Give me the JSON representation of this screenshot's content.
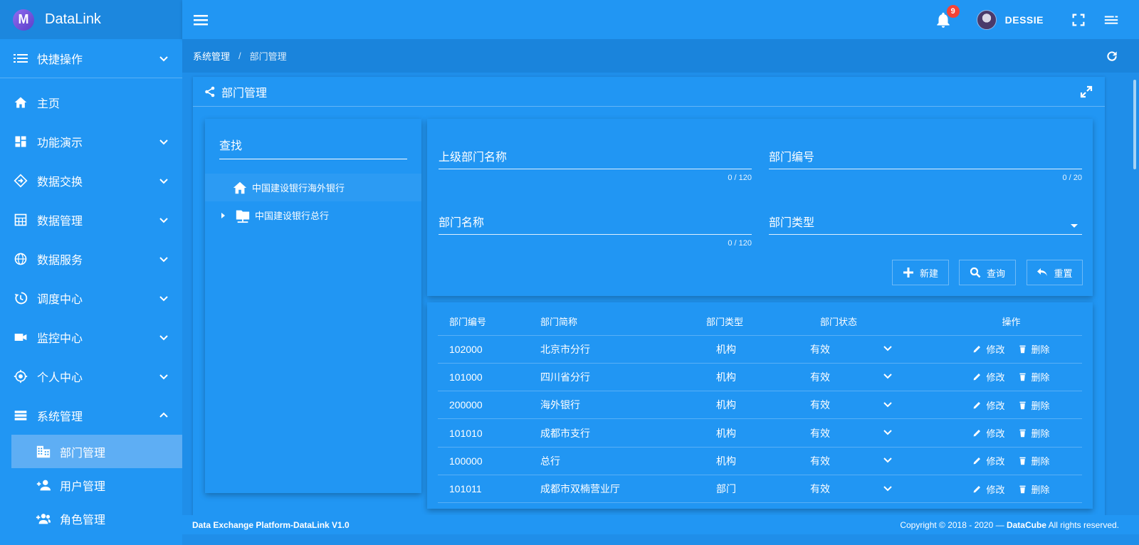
{
  "app": {
    "name": "DataLink",
    "logo_letter": "M"
  },
  "sidebar": {
    "quick_label": "快捷操作",
    "items": [
      {
        "label": "主页",
        "icon": "home-icon",
        "expandable": false
      },
      {
        "label": "功能演示",
        "icon": "dashboard-icon",
        "expandable": true
      },
      {
        "label": "数据交换",
        "icon": "swap-icon",
        "expandable": true
      },
      {
        "label": "数据管理",
        "icon": "grid-icon",
        "expandable": true
      },
      {
        "label": "数据服务",
        "icon": "globe-icon",
        "expandable": true
      },
      {
        "label": "调度中心",
        "icon": "history-icon",
        "expandable": true
      },
      {
        "label": "监控中心",
        "icon": "camera-icon",
        "expandable": true
      },
      {
        "label": "个人中心",
        "icon": "target-icon",
        "expandable": true
      },
      {
        "label": "系统管理",
        "icon": "storage-icon",
        "expandable": true,
        "expanded": true
      }
    ],
    "subitems": [
      {
        "label": "部门管理",
        "icon": "building-icon",
        "active": true
      },
      {
        "label": "用户管理",
        "icon": "person-add-icon",
        "active": false
      },
      {
        "label": "角色管理",
        "icon": "group-add-icon",
        "active": false
      }
    ]
  },
  "topbar": {
    "notifications": "9",
    "username": "DESSIE"
  },
  "breadcrumb": {
    "parent": "系统管理",
    "separator": "/",
    "current": "部门管理"
  },
  "panel": {
    "title": "部门管理"
  },
  "tree": {
    "search_label": "查找",
    "nodes": [
      {
        "label": "中国建设银行海外银行"
      },
      {
        "label": "中国建设银行总行"
      }
    ]
  },
  "form": {
    "parent_name": {
      "label": "上级部门名称",
      "counter": "0 / 120"
    },
    "dept_code": {
      "label": "部门编号",
      "counter": "0 / 20"
    },
    "dept_name": {
      "label": "部门名称",
      "counter": "0 / 120"
    },
    "dept_type": {
      "label": "部门类型"
    },
    "buttons": {
      "new": "新建",
      "query": "查询",
      "reset": "重置"
    }
  },
  "table": {
    "headers": {
      "id": "部门编号",
      "name": "部门简称",
      "type": "部门类型",
      "status": "部门状态",
      "ops": "操作"
    },
    "edit_label": "修改",
    "delete_label": "删除",
    "rows": [
      {
        "id": "102000",
        "name": "北京市分行",
        "type": "机构",
        "status": "有效"
      },
      {
        "id": "101000",
        "name": "四川省分行",
        "type": "机构",
        "status": "有效"
      },
      {
        "id": "200000",
        "name": "海外银行",
        "type": "机构",
        "status": "有效"
      },
      {
        "id": "101010",
        "name": "成都市支行",
        "type": "机构",
        "status": "有效"
      },
      {
        "id": "100000",
        "name": "总行",
        "type": "机构",
        "status": "有效"
      },
      {
        "id": "101011",
        "name": "成都市双楠营业厅",
        "type": "部门",
        "status": "有效"
      }
    ]
  },
  "footer": {
    "left": "Data Exchange Platform-DataLink V1.0",
    "right_prefix": "Copyright © 2018 - 2020 — ",
    "right_brand": "DataCube",
    "right_suffix": " All rights reserved."
  }
}
